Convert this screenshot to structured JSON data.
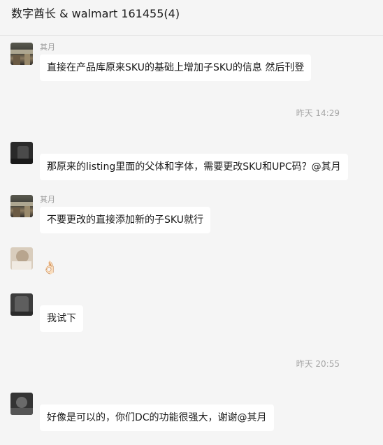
{
  "chat": {
    "title": "数字酋长 & walmart 161455(4)"
  },
  "messages": [
    {
      "sender": "其月",
      "text": "直接在产品库原来SKU的基础上增加子SKU的信息 然后刊登"
    },
    {
      "timestamp": "昨天 14:29"
    },
    {
      "sender": "",
      "text": "那原来的listing里面的父体和字体，需要更改SKU和UPC码？@其月"
    },
    {
      "sender": "其月",
      "text": "不要更改的直接添加新的子SKU就行"
    },
    {
      "sender": "",
      "emoji": "👌🏻",
      "emoji_name": "ok-hand-emoji"
    },
    {
      "sender": "",
      "text": "我试下"
    },
    {
      "timestamp": "昨天 20:55"
    },
    {
      "sender": "",
      "text": "好像是可以的，你们DC的功能很强大，谢谢@其月"
    }
  ],
  "colors": {
    "background": "#f5f5f5",
    "bubble": "#ffffff",
    "timestamp": "#a6a6a6",
    "sender": "#9b9b9b"
  }
}
